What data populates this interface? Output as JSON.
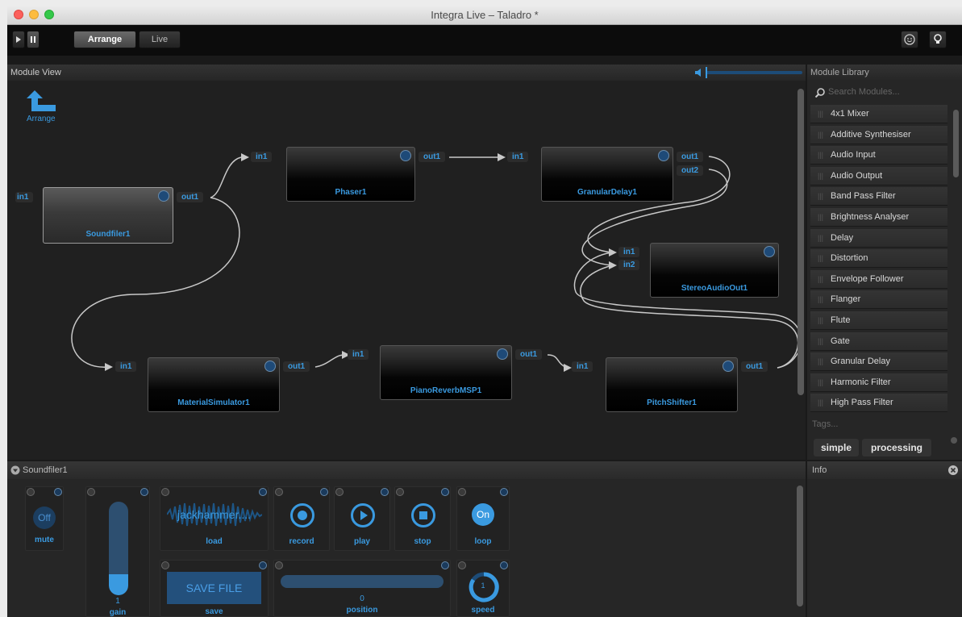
{
  "window": {
    "title": "Integra Live – Taladro *"
  },
  "toolbar": {
    "arrange_label": "Arrange",
    "live_label": "Live"
  },
  "module_view": {
    "header": "Module View",
    "arrange_link": "Arrange",
    "modules": {
      "soundfiler": "Soundfiler1",
      "phaser": "Phaser1",
      "granular": "GranularDelay1",
      "stereo": "StereoAudioOut1",
      "material": "MaterialSimulator1",
      "piano": "PianoReverbMSP1",
      "pitch": "PitchShifter1"
    },
    "ports": {
      "in1": "in1",
      "in2": "in2",
      "out1": "out1",
      "out2": "out2"
    }
  },
  "library": {
    "header": "Module Library",
    "search_placeholder": "Search Modules...",
    "items": [
      "4x1 Mixer",
      "Additive Synthesiser",
      "Audio Input",
      "Audio Output",
      "Band Pass Filter",
      "Brightness Analyser",
      "Delay",
      "Distortion",
      "Envelope Follower",
      "Flanger",
      "Flute",
      "Gate",
      "Granular Delay",
      "Harmonic Filter",
      "High Pass Filter"
    ],
    "tags_label": "Tags...",
    "tags": [
      "simple",
      "processing"
    ]
  },
  "properties": {
    "header": "Soundfiler1",
    "mute": {
      "label": "mute",
      "value": "Off"
    },
    "gain": {
      "label": "gain",
      "value": "1",
      "level": 0.22
    },
    "load": {
      "label": "load",
      "file": "jackhammer...."
    },
    "record": {
      "label": "record"
    },
    "play": {
      "label": "play"
    },
    "stop": {
      "label": "stop"
    },
    "loop": {
      "label": "loop",
      "value": "On"
    },
    "save": {
      "label": "save",
      "button": "SAVE FILE"
    },
    "position": {
      "label": "position",
      "value": "0"
    },
    "speed": {
      "label": "speed",
      "value": "1"
    }
  },
  "info": {
    "header": "Info"
  },
  "colors": {
    "accent": "#3a9ae0",
    "background": "#202020",
    "module_led": "#1e4a78"
  }
}
